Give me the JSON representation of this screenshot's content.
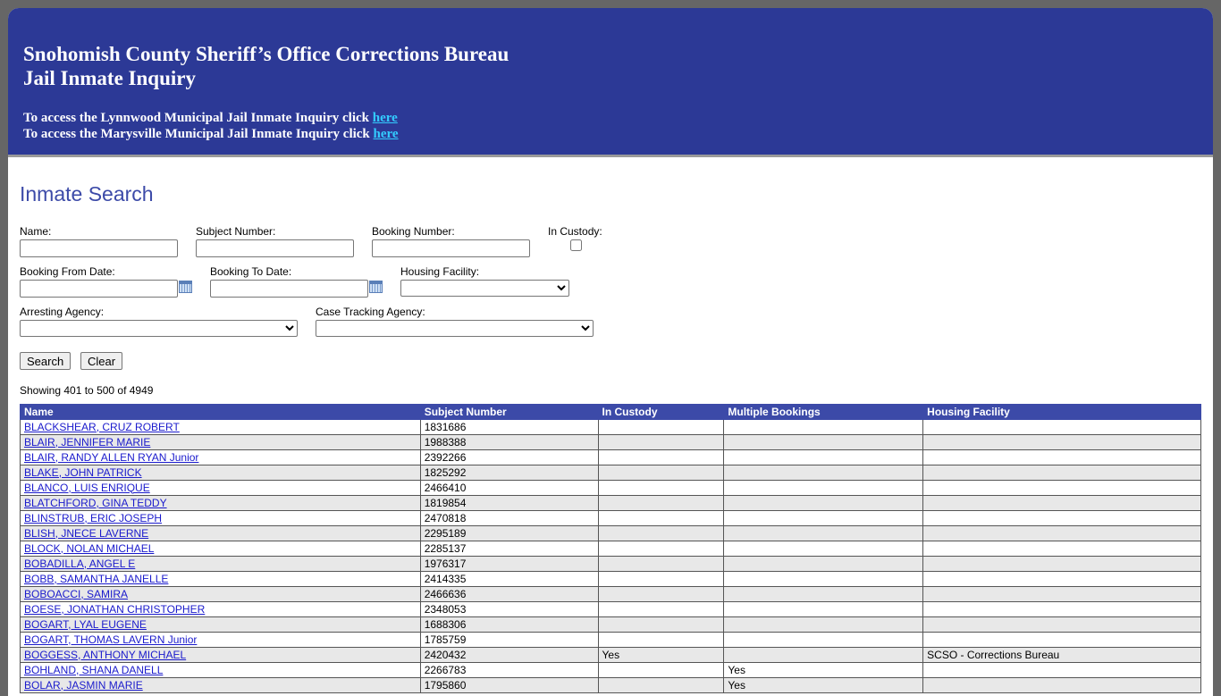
{
  "header": {
    "title_line1": "Snohomish County Sheriff’s Office Corrections Bureau",
    "title_line2": "Jail Inmate Inquiry",
    "lynnwood_text": "To access the Lynnwood Municipal Jail Inmate Inquiry click ",
    "marysville_text": "To access the Marysville Municipal Jail Inmate Inquiry click ",
    "link_label": "here"
  },
  "search": {
    "title": "Inmate Search",
    "name_label": "Name:",
    "name_value": "",
    "subject_label": "Subject Number:",
    "subject_value": "",
    "booking_label": "Booking Number:",
    "booking_value": "",
    "custody_label": "In Custody:",
    "custody_checked": false,
    "from_label": "Booking From Date:",
    "from_value": "",
    "to_label": "Booking To Date:",
    "to_value": "",
    "housing_label": "Housing Facility:",
    "housing_selected": "",
    "arresting_label": "Arresting Agency:",
    "arresting_selected": "",
    "case_label": "Case Tracking Agency:",
    "case_selected": "",
    "search_button": "Search",
    "clear_button": "Clear"
  },
  "results": {
    "showing": "Showing 401 to 500 of 4949",
    "columns": [
      "Name",
      "Subject Number",
      "In Custody",
      "Multiple Bookings",
      "Housing Facility"
    ],
    "rows": [
      {
        "name": "BLACKSHEAR, CRUZ ROBERT",
        "subject": "1831686",
        "custody": "",
        "multiple": "",
        "housing": ""
      },
      {
        "name": "BLAIR, JENNIFER MARIE",
        "subject": "1988388",
        "custody": "",
        "multiple": "",
        "housing": ""
      },
      {
        "name": "BLAIR, RANDY ALLEN RYAN Junior",
        "subject": "2392266",
        "custody": "",
        "multiple": "",
        "housing": ""
      },
      {
        "name": "BLAKE, JOHN PATRICK",
        "subject": "1825292",
        "custody": "",
        "multiple": "",
        "housing": ""
      },
      {
        "name": "BLANCO, LUIS ENRIQUE",
        "subject": "2466410",
        "custody": "",
        "multiple": "",
        "housing": ""
      },
      {
        "name": "BLATCHFORD, GINA TEDDY",
        "subject": "1819854",
        "custody": "",
        "multiple": "",
        "housing": ""
      },
      {
        "name": "BLINSTRUB, ERIC JOSEPH",
        "subject": "2470818",
        "custody": "",
        "multiple": "",
        "housing": ""
      },
      {
        "name": "BLISH, JNECE LAVERNE",
        "subject": "2295189",
        "custody": "",
        "multiple": "",
        "housing": ""
      },
      {
        "name": "BLOCK, NOLAN MICHAEL",
        "subject": "2285137",
        "custody": "",
        "multiple": "",
        "housing": ""
      },
      {
        "name": "BOBADILLA, ANGEL E",
        "subject": "1976317",
        "custody": "",
        "multiple": "",
        "housing": ""
      },
      {
        "name": "BOBB, SAMANTHA JANELLE",
        "subject": "2414335",
        "custody": "",
        "multiple": "",
        "housing": ""
      },
      {
        "name": "BOBOACCI, SAMIRA",
        "subject": "2466636",
        "custody": "",
        "multiple": "",
        "housing": ""
      },
      {
        "name": "BOESE, JONATHAN CHRISTOPHER",
        "subject": "2348053",
        "custody": "",
        "multiple": "",
        "housing": ""
      },
      {
        "name": "BOGART, LYAL EUGENE",
        "subject": "1688306",
        "custody": "",
        "multiple": "",
        "housing": ""
      },
      {
        "name": "BOGART, THOMAS LAVERN Junior",
        "subject": "1785759",
        "custody": "",
        "multiple": "",
        "housing": ""
      },
      {
        "name": "BOGGESS, ANTHONY MICHAEL",
        "subject": "2420432",
        "custody": "Yes",
        "multiple": "",
        "housing": "SCSO - Corrections Bureau"
      },
      {
        "name": "BOHLAND, SHANA DANELL",
        "subject": "2266783",
        "custody": "",
        "multiple": "Yes",
        "housing": ""
      },
      {
        "name": "BOLAR, JASMIN MARIE",
        "subject": "1795860",
        "custody": "",
        "multiple": "Yes",
        "housing": ""
      }
    ]
  }
}
